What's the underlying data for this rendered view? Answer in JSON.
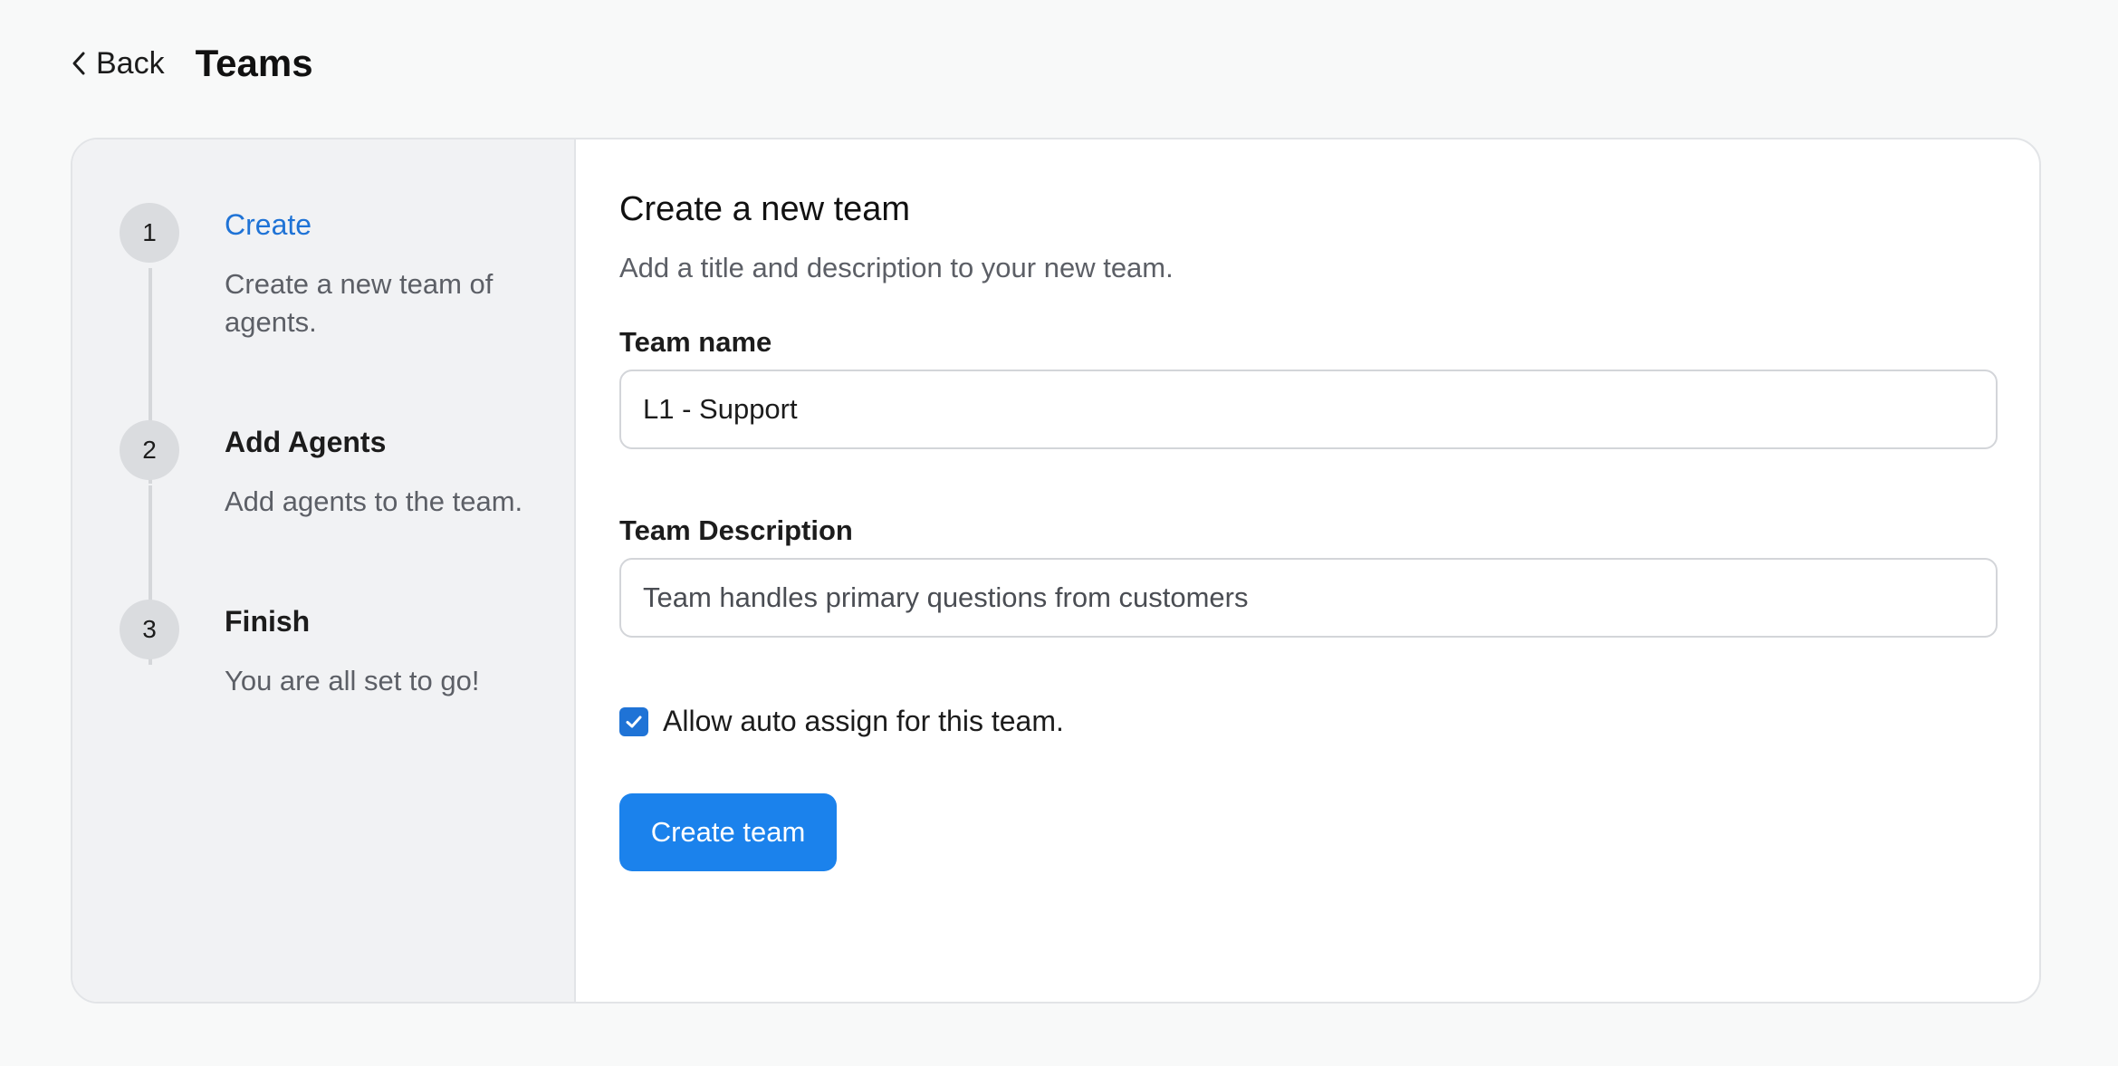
{
  "header": {
    "back_label": "Back",
    "title": "Teams"
  },
  "steps": [
    {
      "number": "1",
      "title": "Create",
      "description": "Create a new team of agents.",
      "active": true
    },
    {
      "number": "2",
      "title": "Add Agents",
      "description": "Add agents to the team.",
      "active": false
    },
    {
      "number": "3",
      "title": "Finish",
      "description": "You are all set to go!",
      "active": false
    }
  ],
  "form": {
    "title": "Create a new team",
    "subtitle": "Add a title and description to your new team.",
    "team_name_label": "Team name",
    "team_name_value": "L1 - Support",
    "team_description_label": "Team Description",
    "team_description_value": "Team handles primary questions from customers",
    "auto_assign_label": "Allow auto assign for this team.",
    "auto_assign_checked": true,
    "submit_label": "Create team"
  },
  "colors": {
    "accent": "#1f73d6",
    "button": "#1b82ec",
    "sidebar_bg": "#f1f2f4"
  }
}
